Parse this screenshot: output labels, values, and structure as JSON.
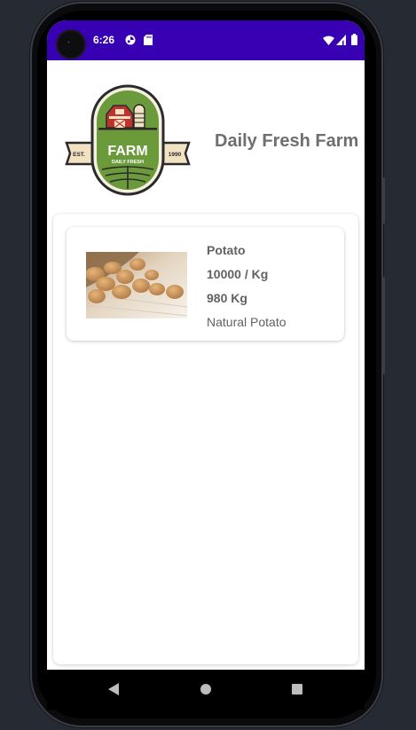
{
  "status_bar": {
    "time": "6:26",
    "notification_icons": [
      "app-notification-icon",
      "sd-card-icon"
    ],
    "system_icons": [
      "wifi-icon",
      "signal-icon",
      "battery-icon"
    ],
    "background_color": "#3700b3"
  },
  "header": {
    "title": "Daily Fresh Farm",
    "logo": {
      "main_text": "FARM",
      "sub_text": "DAILY FRESH",
      "est_label": "EST.",
      "year": "1990",
      "colors": {
        "green": "#6a9a3a",
        "red": "#c0322e",
        "cream": "#f1e2c2",
        "dark": "#2b2b2b"
      }
    }
  },
  "products": [
    {
      "name": "Potato",
      "price": "10000 / Kg",
      "stock": "980 Kg",
      "description": "Natural Potato",
      "image": "potato-photo"
    }
  ],
  "nav_bar": {
    "buttons": [
      "back-button",
      "home-button",
      "recents-button"
    ]
  }
}
